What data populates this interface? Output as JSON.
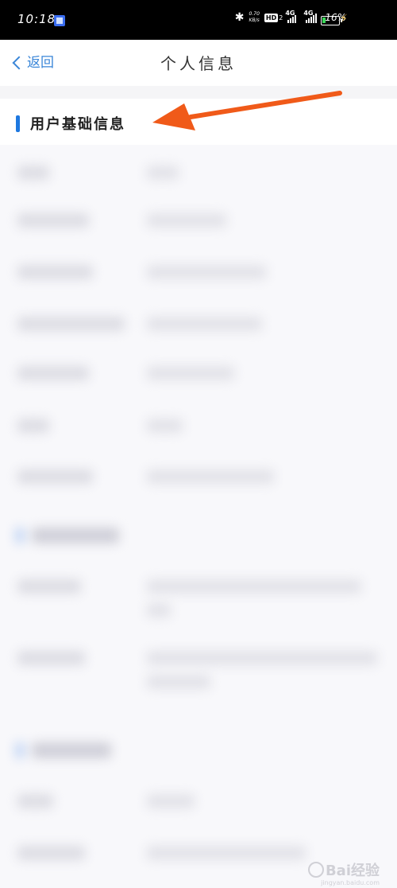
{
  "status_bar": {
    "time": "10:18",
    "net_speed_value": "0.70",
    "net_speed_unit": "KB/s",
    "hd_label": "HD",
    "hd_sub": "2",
    "signal1_label": "4G",
    "signal2_label": "4G",
    "battery_percent": "16%",
    "battery_level": 0.16
  },
  "nav": {
    "back_label": "返回",
    "title": "个人信息"
  },
  "section": {
    "title": "用户基础信息"
  },
  "watermark": {
    "brand": "Bai经验",
    "url": "jingyan.baidu.com"
  },
  "colors": {
    "accent": "#1e78e0",
    "link": "#3a86d8",
    "arrow": "#f05a19",
    "battery": "#3bd95a"
  }
}
